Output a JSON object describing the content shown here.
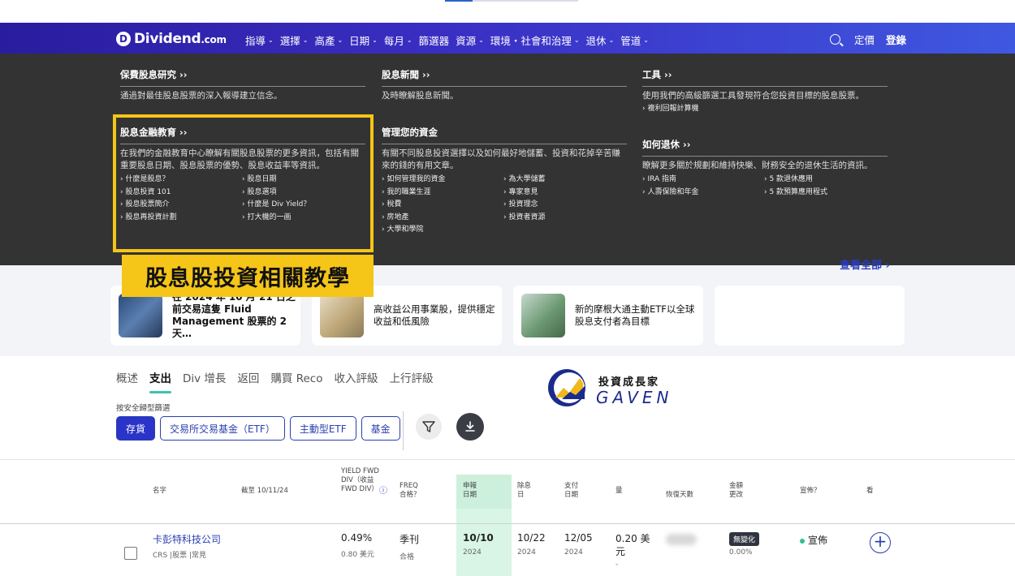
{
  "brand": {
    "logo_letter": "D",
    "name": "Dividend",
    "tld": ".com"
  },
  "nav": {
    "items": [
      "指導",
      "選擇",
      "高產",
      "日期",
      "每月",
      "篩選器",
      "資源",
      "環境・社會和治理",
      "退休",
      "管道"
    ],
    "pricing": "定價",
    "login": "登錄"
  },
  "mega": {
    "research": {
      "title": "保費股息研究 ››",
      "desc": "通過對最佳股息股票的深入報導建立信念。"
    },
    "news": {
      "title": "股息新聞 ››",
      "desc": "及時瞭解股息新聞。"
    },
    "tools": {
      "title": "工具 ››",
      "desc": "使用我們的高級篩選工具發現符合您投資目標的股息股票。",
      "links": [
        "複利回報計算機"
      ]
    },
    "education": {
      "title": "股息金融教育 ››",
      "desc": "在我們的金融教育中心瞭解有關股息股票的更多資訊，包括有關重要股息日期、股息股票的優勢、股息收益率等資訊。",
      "links": [
        "什麼是股息？",
        "股息日期",
        "股息投資 101",
        "股息選項",
        "股息股票簡介",
        "什麼是 Div Yield？",
        "股息再投資計劃",
        "打大機的一画"
      ]
    },
    "money": {
      "title": "管理您的資金",
      "desc": "有關不同股息投資選擇以及如何最好地儲蓄、投資和花掉辛苦賺來的錢的有用文章。",
      "links": [
        "如何管理我的資金",
        "為大學儲蓄",
        "我的職業生涯",
        "專家意見",
        "稅費",
        "投資理念",
        "房地產",
        "投資者資源",
        "大學和學院"
      ]
    },
    "retire": {
      "title": "如何退休 ››",
      "desc": "瞭解更多關於規劃和維持快樂、財務安全的退休生活的資訊。",
      "links": [
        "IRA 指南",
        "5 款退休應用",
        "人壽保險和年金",
        "5 款預算應用程式"
      ]
    }
  },
  "callout": "股息股投資相關教學",
  "view_all": "查看全部",
  "cards": [
    {
      "text": "在 2024 年 10 月 21 日之前交易這隻 Fluid Management 股票的 2 天…",
      "thumb": "#3a5a8a"
    },
    {
      "text": "高收益公用事業股，提供穩定收益和低風險",
      "thumb": "#c9b48a"
    },
    {
      "text": "新的摩根大通主動ETF以全球股息支付者為目標",
      "thumb": "#6c9a72"
    }
  ],
  "tabs": [
    "概述",
    "支出",
    "Div 增長",
    "返回",
    "購買 Reco",
    "收入評級",
    "上行評級"
  ],
  "filter_label": "按安全歸型篩選",
  "chips": [
    "存貨",
    "交易所交易基金（ETF）",
    "主動型ETF",
    "基金"
  ],
  "watermark": {
    "title": "投資成長家",
    "sub": "GAVEN"
  },
  "table": {
    "headers": {
      "name": "名字",
      "as_of": "截至 10/11/24",
      "yield": "YIELD FWD DIV（收益 FWD DIV）",
      "freq": "FREQ 合格？",
      "declared": "申報 日期",
      "ex_date": "除息 日",
      "pay_date": "支付 日期",
      "amount": "量",
      "recovery": "恢復天數",
      "change": "金額 更改",
      "announced": "宣佈？",
      "view": "看"
    },
    "rows": [
      {
        "name": "卡彭特科技公司",
        "meta": "CRS |股票 |常見",
        "yield": "0.49%",
        "div": "0.80 美元",
        "freq": "季刊",
        "qualified": "合格",
        "declared": "10/10",
        "declared_year": "2024",
        "ex_date": "10/22",
        "ex_year": "2024",
        "pay_date": "12/05",
        "pay_year": "2024",
        "amount": "0.20 美元",
        "amount_extra": "-",
        "change_badge": "無變化",
        "change_pct": "0.00%",
        "announced": "宣佈"
      }
    ]
  },
  "colors": {
    "nav_start": "#2a1c9e",
    "nav_end": "#3f58e0",
    "highlight": "#f5c518",
    "accent": "#2a34c8",
    "tab_underline": "#3bc3b0"
  }
}
